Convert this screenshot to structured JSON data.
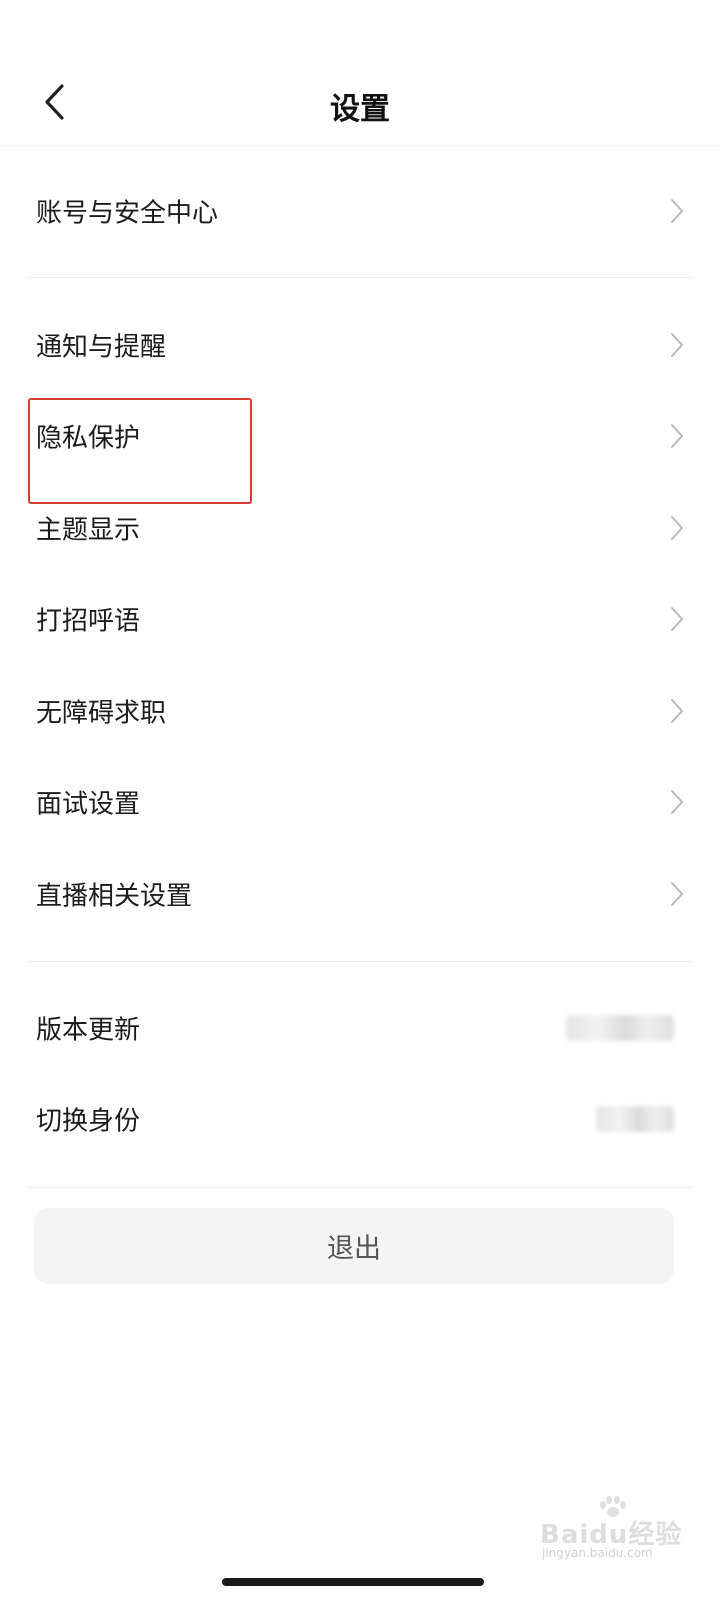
{
  "header": {
    "title": "设置",
    "back_icon": "chevron-left-icon"
  },
  "sections": [
    {
      "items": [
        {
          "label": "账号与安全中心",
          "chevron": true
        }
      ]
    },
    {
      "items": [
        {
          "label": "通知与提醒",
          "chevron": true
        },
        {
          "label": "隐私保护",
          "chevron": true,
          "highlighted": true
        },
        {
          "label": "主题显示",
          "chevron": true
        },
        {
          "label": "打招呼语",
          "chevron": true
        },
        {
          "label": "无障碍求职",
          "chevron": true
        },
        {
          "label": "面试设置",
          "chevron": true
        },
        {
          "label": "直播相关设置",
          "chevron": true
        }
      ]
    },
    {
      "items": [
        {
          "label": "版本更新",
          "value_blurred": true
        },
        {
          "label": "切换身份",
          "value_blurred": true
        }
      ]
    }
  ],
  "logout_button": {
    "label": "退出"
  },
  "watermark": {
    "text": "Baidu经验",
    "sub": "jingyan.baidu.com"
  },
  "colors": {
    "highlight_border": "#d93a35",
    "divider": "#ececec",
    "button_bg": "#f4f4f4"
  }
}
